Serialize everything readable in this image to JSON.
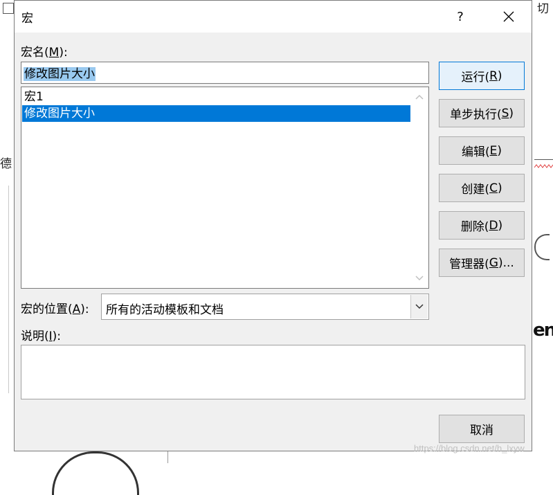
{
  "dialog": {
    "title": "宏",
    "help_label": "?"
  },
  "macro_name": {
    "label_prefix": "宏名(",
    "label_key": "M",
    "label_suffix": "):",
    "value": "修改图片大小"
  },
  "macro_list": {
    "items": [
      {
        "label": "宏1",
        "selected": false
      },
      {
        "label": "修改图片大小",
        "selected": true
      }
    ]
  },
  "location": {
    "label_prefix": "宏的位置(",
    "label_key": "A",
    "label_suffix": "):",
    "value": "所有的活动模板和文档"
  },
  "description": {
    "label_prefix": "说明(",
    "label_key": "I",
    "label_suffix": "):",
    "value": ""
  },
  "buttons": {
    "run": {
      "prefix": "运行(",
      "key": "R",
      "suffix": ")"
    },
    "step": {
      "prefix": "单步执行(",
      "key": "S",
      "suffix": ")"
    },
    "edit": {
      "prefix": "编辑(",
      "key": "E",
      "suffix": ")"
    },
    "create": {
      "prefix": "创建(",
      "key": "C",
      "suffix": ")"
    },
    "delete": {
      "prefix": "删除(",
      "key": "D",
      "suffix": ")"
    },
    "organizer": {
      "prefix": "管理器(",
      "key": "G",
      "suffix": ")..."
    },
    "cancel": {
      "label": "取消"
    }
  },
  "background": {
    "left_char": "德",
    "right_char": "切",
    "logo_fragment": "en"
  },
  "watermark": "https://blog.csdn.net/h_lxyw",
  "colors": {
    "selection": "#0078d7",
    "input_selection": "#99c9ef",
    "dialog_bg": "#f0f0f0"
  }
}
